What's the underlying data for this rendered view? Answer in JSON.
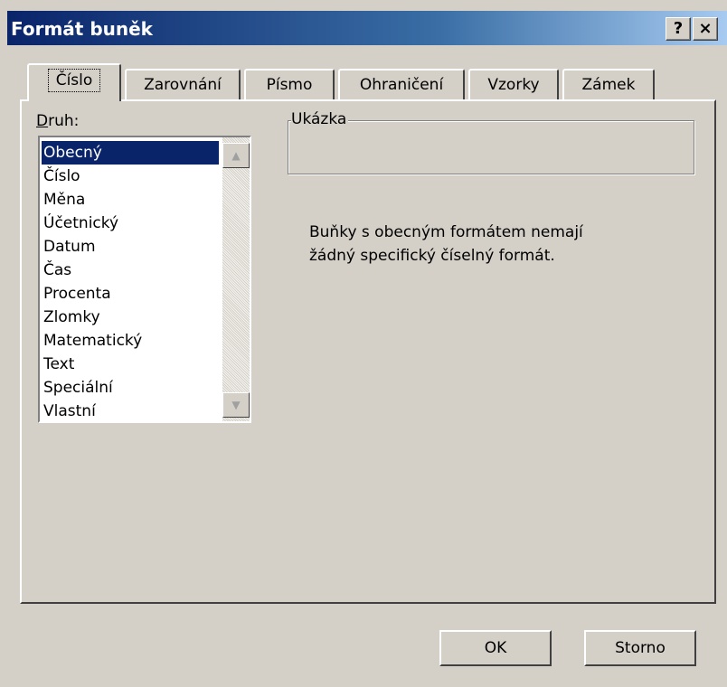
{
  "window": {
    "title": "Formát buněk",
    "help_label": "?",
    "close_label": "×"
  },
  "tabs": [
    {
      "label": "Číslo",
      "active": true
    },
    {
      "label": "Zarovnání"
    },
    {
      "label": "Písmo"
    },
    {
      "label": "Ohraničení"
    },
    {
      "label": "Vzorky"
    },
    {
      "label": "Zámek"
    }
  ],
  "category": {
    "label_accel": "D",
    "label_rest": "ruh:",
    "items": [
      "Obecný",
      "Číslo",
      "Měna",
      "Účetnický",
      "Datum",
      "Čas",
      "Procenta",
      "Zlomky",
      "Matematický",
      "Text",
      "Speciální",
      "Vlastní"
    ],
    "selected": "Obecný"
  },
  "sample": {
    "legend": "Ukázka",
    "value": ""
  },
  "description": {
    "line1": "Buňky s obecným formátem nemají",
    "line2": "žádný specifický číselný formát."
  },
  "buttons": {
    "ok": "OK",
    "cancel": "Storno"
  },
  "colors": {
    "dialog_bg": "#d4d0c8",
    "title_start": "#0a246a",
    "title_end": "#a6caf0",
    "selection": "#0a246a"
  }
}
